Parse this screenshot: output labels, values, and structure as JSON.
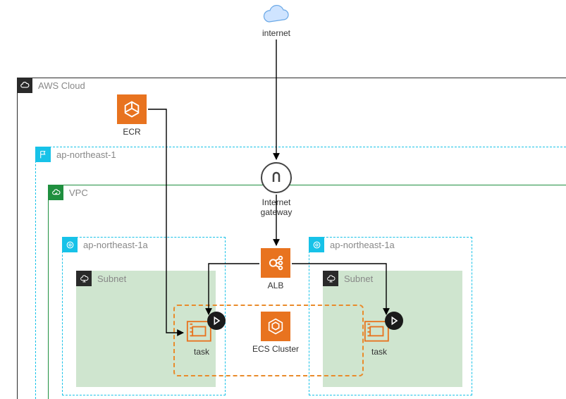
{
  "internet": {
    "label": "internet"
  },
  "aws_cloud": {
    "label": "AWS Cloud"
  },
  "ecr": {
    "label": "ECR"
  },
  "region": {
    "label": "ap-northeast-1"
  },
  "vpc": {
    "label": "VPC"
  },
  "igw": {
    "line1": "Internet",
    "line2": "gateway"
  },
  "alb": {
    "label": "ALB"
  },
  "ecs": {
    "label": "ECS Cluster"
  },
  "az_a": {
    "label": "ap-northeast-1a",
    "subnet_label": "Subnet",
    "task_label": "task"
  },
  "az_b": {
    "label": "ap-northeast-1a",
    "subnet_label": "Subnet",
    "task_label": "task"
  },
  "chart_data": {
    "type": "diagram",
    "nodes": [
      {
        "id": "internet",
        "label": "internet"
      },
      {
        "id": "aws_cloud",
        "label": "AWS Cloud"
      },
      {
        "id": "ecr",
        "label": "ECR",
        "parent": "aws_cloud"
      },
      {
        "id": "region",
        "label": "ap-northeast-1",
        "parent": "aws_cloud"
      },
      {
        "id": "vpc",
        "label": "VPC",
        "parent": "region"
      },
      {
        "id": "igw",
        "label": "Internet gateway",
        "parent": "region"
      },
      {
        "id": "alb",
        "label": "ALB",
        "parent": "vpc"
      },
      {
        "id": "ecs",
        "label": "ECS Cluster",
        "parent": "vpc"
      },
      {
        "id": "az_a",
        "label": "ap-northeast-1a",
        "parent": "vpc"
      },
      {
        "id": "subnet_a",
        "label": "Subnet",
        "parent": "az_a"
      },
      {
        "id": "task_a",
        "label": "task",
        "parent": "subnet_a"
      },
      {
        "id": "az_b",
        "label": "ap-northeast-1a",
        "parent": "vpc"
      },
      {
        "id": "subnet_b",
        "label": "Subnet",
        "parent": "az_b"
      },
      {
        "id": "task_b",
        "label": "task",
        "parent": "subnet_b"
      }
    ],
    "edges": [
      {
        "from": "internet",
        "to": "igw"
      },
      {
        "from": "igw",
        "to": "alb"
      },
      {
        "from": "ecr",
        "to": "task_a"
      },
      {
        "from": "alb",
        "to": "task_a"
      },
      {
        "from": "alb",
        "to": "task_b"
      }
    ]
  }
}
